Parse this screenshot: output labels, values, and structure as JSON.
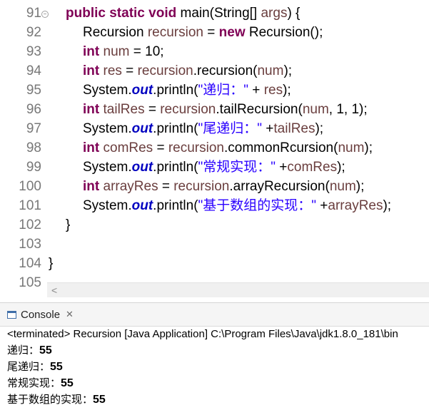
{
  "editor": {
    "line_numbers": [
      "91",
      "92",
      "93",
      "94",
      "95",
      "96",
      "97",
      "98",
      "99",
      "100",
      "101",
      "102",
      "103",
      "104",
      "105"
    ],
    "code": {
      "l91": {
        "kw1": "public",
        "kw2": "static",
        "kw3": "void",
        "a": "main(String[] ",
        "var": "args",
        "b": ") {"
      },
      "l92": {
        "a": "Recursion ",
        "var": "recursion",
        "b": " = ",
        "kw": "new",
        "c": " Recursion();"
      },
      "l93": {
        "kw": "int",
        "var": "num",
        "b": " = 10;"
      },
      "l94": {
        "kw": "int",
        "var": "res",
        "b": " = ",
        "var2": "recursion",
        "c": ".recursion(",
        "var3": "num",
        "d": ");"
      },
      "l95": {
        "a": "System.",
        "fld": "out",
        "b": ".println(",
        "str": "\"递归：\"",
        "c": " + ",
        "var": "res",
        "d": ");"
      },
      "l96": {
        "kw": "int",
        "var": "tailRes",
        "b": " = ",
        "var2": "recursion",
        "c": ".tailRecursion(",
        "var3": "num",
        "d": ", 1, 1);"
      },
      "l97": {
        "a": "System.",
        "fld": "out",
        "b": ".println(",
        "str": "\"尾递归：\"",
        "c": " +",
        "var": "tailRes",
        "d": ");"
      },
      "l98": {
        "kw": "int",
        "var": "comRes",
        "b": " = ",
        "var2": "recursion",
        "c": ".commonRcursion(",
        "var3": "num",
        "d": ");"
      },
      "l99": {
        "a": "System.",
        "fld": "out",
        "b": ".println(",
        "str": "\"常规实现：\"",
        "c": " +",
        "var": "comRes",
        "d": ");"
      },
      "l100": {
        "kw": "int",
        "var": "arrayRes",
        "b": " = ",
        "var2": "recursion",
        "c": ".arrayRecursion(",
        "var3": "num",
        "d": ");"
      },
      "l101": {
        "a": "System.",
        "fld": "out",
        "b": ".println(",
        "str": "\"基于数组的实现：\"",
        "c": " +",
        "var": "arrayRes",
        "d": ");"
      },
      "l102": "}",
      "l104": "}"
    }
  },
  "console": {
    "tab_label": "Console",
    "tab_close": "✕",
    "status": "<terminated> Recursion [Java Application] C:\\Program Files\\Java\\jdk1.8.0_181\\bin",
    "output": [
      {
        "label": "递归：",
        "value": "55"
      },
      {
        "label": "尾递归：",
        "value": "55"
      },
      {
        "label": "常规实现：",
        "value": "55"
      },
      {
        "label": "基于数组的实现：",
        "value": "55"
      }
    ]
  },
  "scrollbar": {
    "left_arrow": "<"
  },
  "icons": {
    "fold": "fold-collapse-icon",
    "console": "console-icon",
    "close": "close-icon",
    "scroll_left": "chevron-left-icon"
  },
  "colors": {
    "keyword": "#7f0055",
    "variable": "#6a3e3e",
    "field": "#0000c0",
    "string": "#2a00ff",
    "line_number": "#787878"
  }
}
